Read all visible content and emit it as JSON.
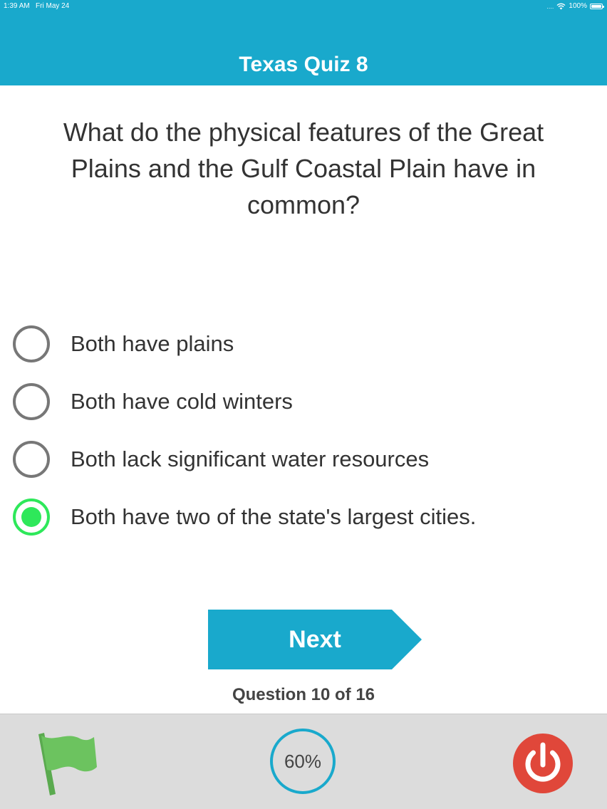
{
  "status_bar": {
    "time": "1:39 AM",
    "date": "Fri May 24",
    "signal": "....",
    "battery": "100%"
  },
  "header": {
    "title": "Texas Quiz 8",
    "color": "#19a9cc"
  },
  "question": {
    "text": "What do the physical features of the Great Plains and the Gulf Coastal Plain have in common?"
  },
  "answers": [
    {
      "label": "Both have plains",
      "selected": false
    },
    {
      "label": "Both have cold winters",
      "selected": false
    },
    {
      "label": "Both lack significant water resources",
      "selected": false
    },
    {
      "label": "Both have two of the state's largest cities.",
      "selected": true
    }
  ],
  "next_button": {
    "label": "Next"
  },
  "progress": {
    "text": "Question 10 of 16",
    "current": 10,
    "total": 16
  },
  "footer": {
    "percent": "60%",
    "icons": [
      "flag-icon",
      "power-icon"
    ],
    "colors": {
      "flag": "#6cc35f",
      "power": "#e0473a",
      "selected": "#2ee85a"
    }
  }
}
